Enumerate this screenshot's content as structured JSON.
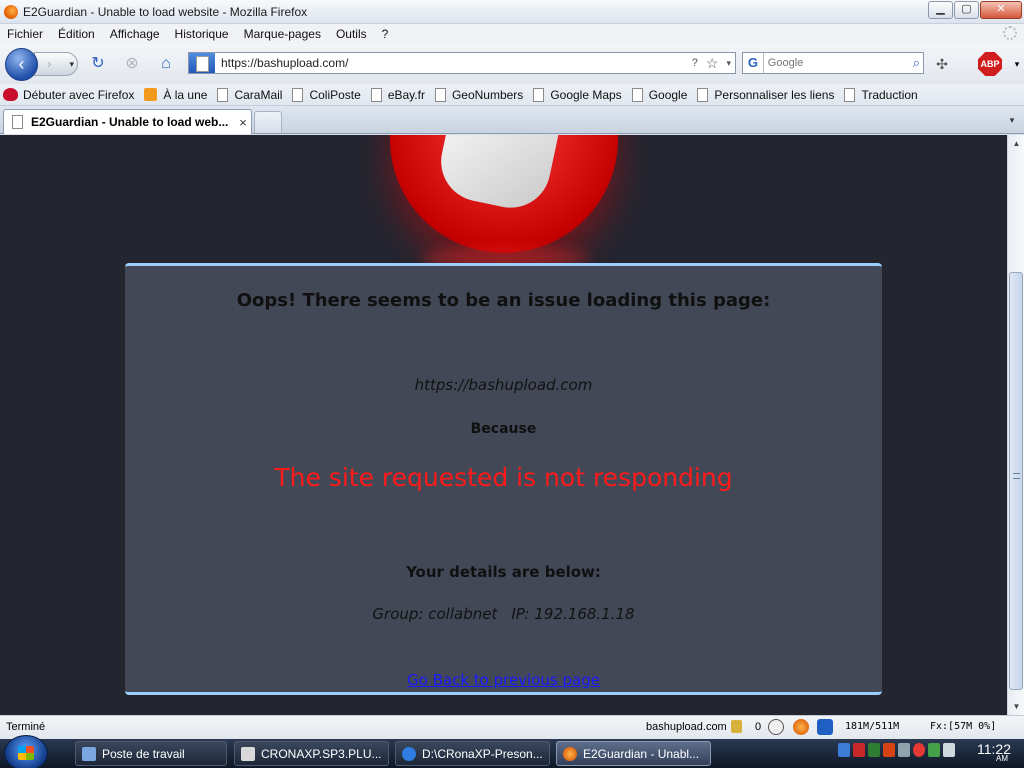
{
  "window": {
    "title": "E2Guardian - Unable to load website - Mozilla Firefox",
    "controls": {
      "minimize": "▁",
      "maximize": "▢",
      "close": "✕"
    }
  },
  "menu": [
    "Fichier",
    "Édition",
    "Affichage",
    "Historique",
    "Marque-pages",
    "Outils",
    "?"
  ],
  "toolbar": {
    "url": "https://bashupload.com/",
    "search_placeholder": "Google",
    "search_engine_letter": "G",
    "abp_label": "ABP"
  },
  "bookmarks": [
    "Débuter avec Firefox",
    "À la une",
    "CaraMail",
    "ColiPoste",
    "eBay.fr",
    "GeoNumbers",
    "Google Maps",
    "Google",
    "Personnaliser les liens",
    "Traduction"
  ],
  "tab": {
    "label": "E2Guardian - Unable to load web...",
    "close": "×"
  },
  "page": {
    "heading": "Oops! There seems to be an issue loading this page:",
    "url": "https://bashupload.com",
    "because": "Because",
    "error": "The site requested is not responding",
    "details_heading": "Your details are below:",
    "group": "Group: collabnet",
    "ip": "IP: 192.168.1.18",
    "go_back": "Go Back to previous page"
  },
  "statusbar": {
    "status": "Terminé",
    "host": "bashupload.com",
    "count": "0",
    "memory": "181M/511M",
    "fx": "Fx:[57M  0%]"
  },
  "taskbar": {
    "items": [
      "Poste de travail",
      "CRONAXP.SP3.PLU...",
      "D:\\CRonaXP-Preson...",
      "E2Guardian - Unabl..."
    ],
    "clock": "11:22",
    "ampm": "AM"
  },
  "colors": {
    "error_red": "#ff1a1a",
    "panel_bg": "#434857",
    "page_bg": "#23252f",
    "link_blue": "#1a1aff",
    "panel_border": "#9ccfff"
  }
}
